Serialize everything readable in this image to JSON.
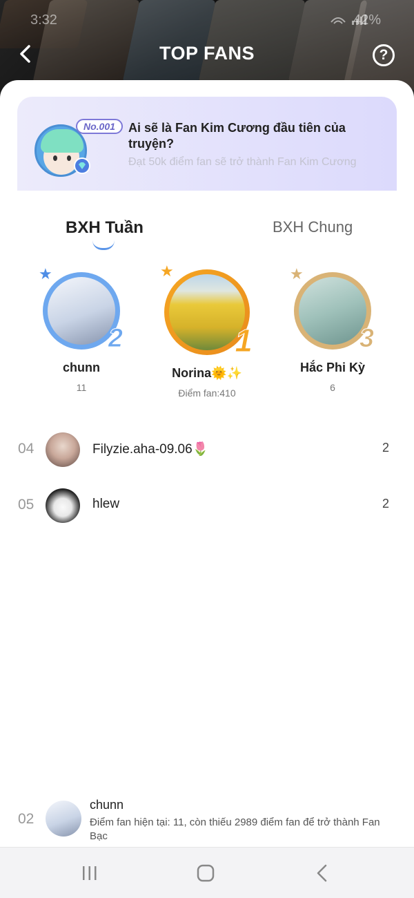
{
  "status_bar": {
    "time": "3:32",
    "battery": "42%"
  },
  "header": {
    "title": "TOP FANS"
  },
  "promo": {
    "number": "No.001",
    "title": "Ai sẽ là Fan Kim Cương đầu tiên của truyện?",
    "subtitle": "Đạt 50k điểm fan sẽ trở thành Fan Kim Cương"
  },
  "tabs": [
    {
      "label": "BXH Tuần",
      "active": true
    },
    {
      "label": "BXH Chung",
      "active": false
    }
  ],
  "podium": [
    {
      "rank": "2",
      "name": "chunn",
      "score": "11"
    },
    {
      "rank": "1",
      "name": "Norina🌞✨",
      "score": "Điểm fan:410"
    },
    {
      "rank": "3",
      "name": "Hắc Phi Kỳ",
      "score": "6"
    }
  ],
  "list": [
    {
      "rank": "04",
      "name": "Filyzie.aha-09.06🌷",
      "score": "2"
    },
    {
      "rank": "05",
      "name": "hlew",
      "score": "2"
    }
  ],
  "me": {
    "rank": "02",
    "name": "chunn",
    "description": "Điểm fan hiện tại: 11, còn thiếu 2989 điểm fan để trở thành Fan Bạc"
  },
  "colors": {
    "accent": "#5b95e8",
    "gold": "#f5a623",
    "silver": "#6ea8ef",
    "bronze": "#d9b376"
  }
}
